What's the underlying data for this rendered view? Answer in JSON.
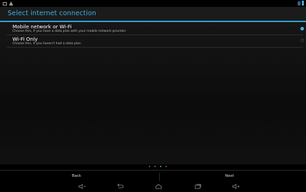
{
  "title": "Select internet connection",
  "options": [
    {
      "title": "Mobile network or Wi-Fi",
      "description": "Choose this, if you have a data plan with your mobile network provider.",
      "selected": true
    },
    {
      "title": "Wi-Fi Only",
      "description": "Choose this, if you haven't had a data plan",
      "selected": false
    }
  ],
  "buttons": {
    "back": "Back",
    "next": "Next"
  },
  "pager": {
    "pages": 4,
    "active_index": 2
  },
  "colors": {
    "accent": "#38b2e6",
    "background": "#000000"
  }
}
